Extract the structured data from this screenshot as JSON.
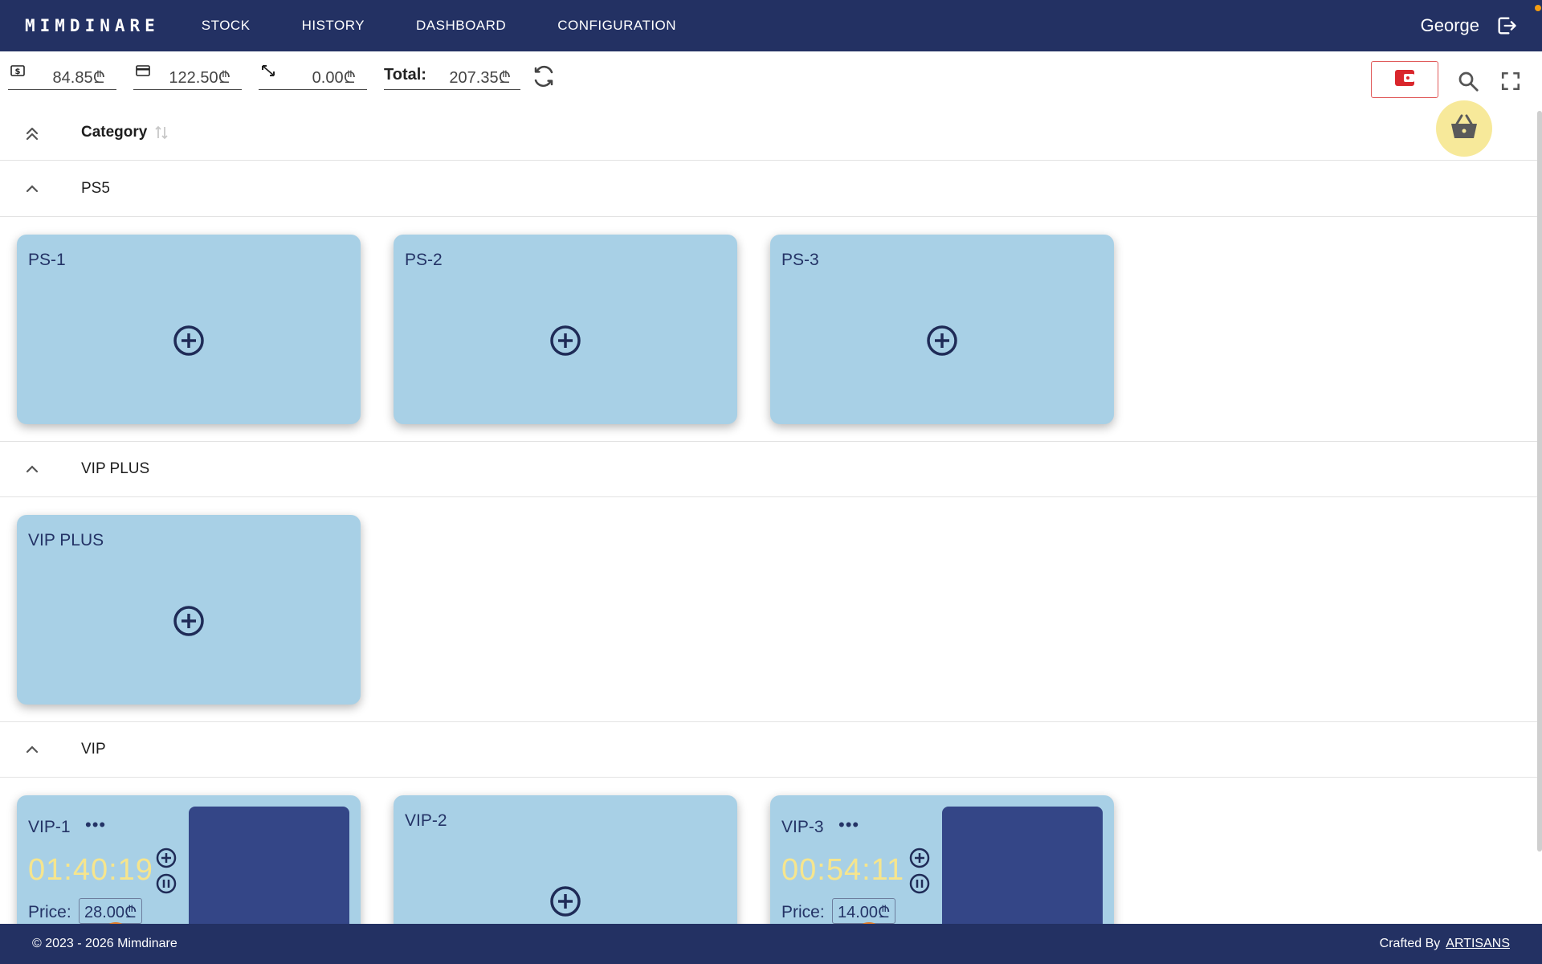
{
  "navbar": {
    "brand": "MIMDINARE",
    "links": [
      "STOCK",
      "HISTORY",
      "DASHBOARD",
      "CONFIGURATION"
    ],
    "user": "George",
    "logout_icon": "logout-icon"
  },
  "toolbar": {
    "cash": "84.85₾",
    "card": "122.50₾",
    "transfer": "0.00₾",
    "total_label": "Total:",
    "total_value": "207.35₾"
  },
  "table_header": {
    "category": "Category"
  },
  "groups": [
    {
      "name": "PS5",
      "cards": [
        {
          "name": "PS-1",
          "state": "empty"
        },
        {
          "name": "PS-2",
          "state": "empty"
        },
        {
          "name": "PS-3",
          "state": "empty"
        }
      ]
    },
    {
      "name": "VIP PLUS",
      "cards": [
        {
          "name": "VIP PLUS",
          "state": "empty"
        }
      ]
    },
    {
      "name": "VIP",
      "cards": [
        {
          "name": "VIP-1",
          "state": "active",
          "timer": "01:40:19",
          "price_label": "Price:",
          "price": "28.00₾"
        },
        {
          "name": "VIP-2",
          "state": "empty"
        },
        {
          "name": "VIP-3",
          "state": "active",
          "timer": "00:54:11",
          "price_label": "Price:",
          "price": "14.00₾"
        }
      ]
    }
  ],
  "footer": {
    "copyright": "© 2023 - 2026 Mimdinare",
    "crafted_by": "Crafted By",
    "crafted_link": "ARTISANS"
  },
  "colors": {
    "navbar": "#233163",
    "card": "#a8d0e6",
    "timer": "#f6e58d",
    "side_panel": "#344687",
    "basket": "#f7e99a",
    "wallet": "#d9262c"
  }
}
